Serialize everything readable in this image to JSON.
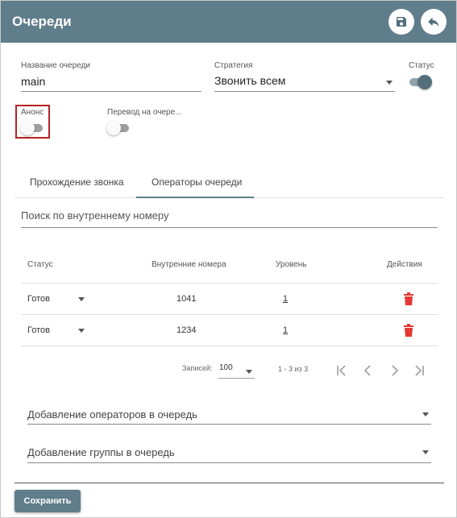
{
  "header": {
    "title": "Очереди",
    "save_icon": "floppy-disk-icon",
    "back_icon": "reply-arrow-icon"
  },
  "form": {
    "queue_name_label": "Название очереди",
    "queue_name_value": "main",
    "strategy_label": "Стратегия",
    "strategy_value": "Звонить всем",
    "status_label": "Статус",
    "status_on": true,
    "announce_label": "Анонс",
    "announce_on": false,
    "transfer_label": "Перевод на очере...",
    "transfer_on": false
  },
  "tabs": [
    {
      "label": "Прохождение звонка",
      "active": false
    },
    {
      "label": "Операторы очереди",
      "active": true
    }
  ],
  "search": {
    "placeholder": "Поиск по внутреннему номеру"
  },
  "table": {
    "headers": {
      "status": "Статус",
      "numbers": "Внутренние номера",
      "level": "Уровень",
      "actions": "Действия"
    },
    "rows": [
      {
        "status": "Готов",
        "number": "1041",
        "level": "1",
        "action_icon": "trash-icon"
      },
      {
        "status": "Готов",
        "number": "1234",
        "level": "1",
        "action_icon": "trash-icon"
      }
    ]
  },
  "pagination": {
    "records_label": "Записей:",
    "per_page": "100",
    "range": "1 - 3 из 3"
  },
  "add_operators": {
    "placeholder": "Добавление операторов в очередь"
  },
  "add_group": {
    "placeholder": "Добавление группы в очередь"
  },
  "footer": {
    "save_label": "Сохранить"
  },
  "colors": {
    "header": "#607d8b",
    "toggle_on": "#546e7a",
    "delete": "#e53935",
    "highlight": "#b22222"
  }
}
